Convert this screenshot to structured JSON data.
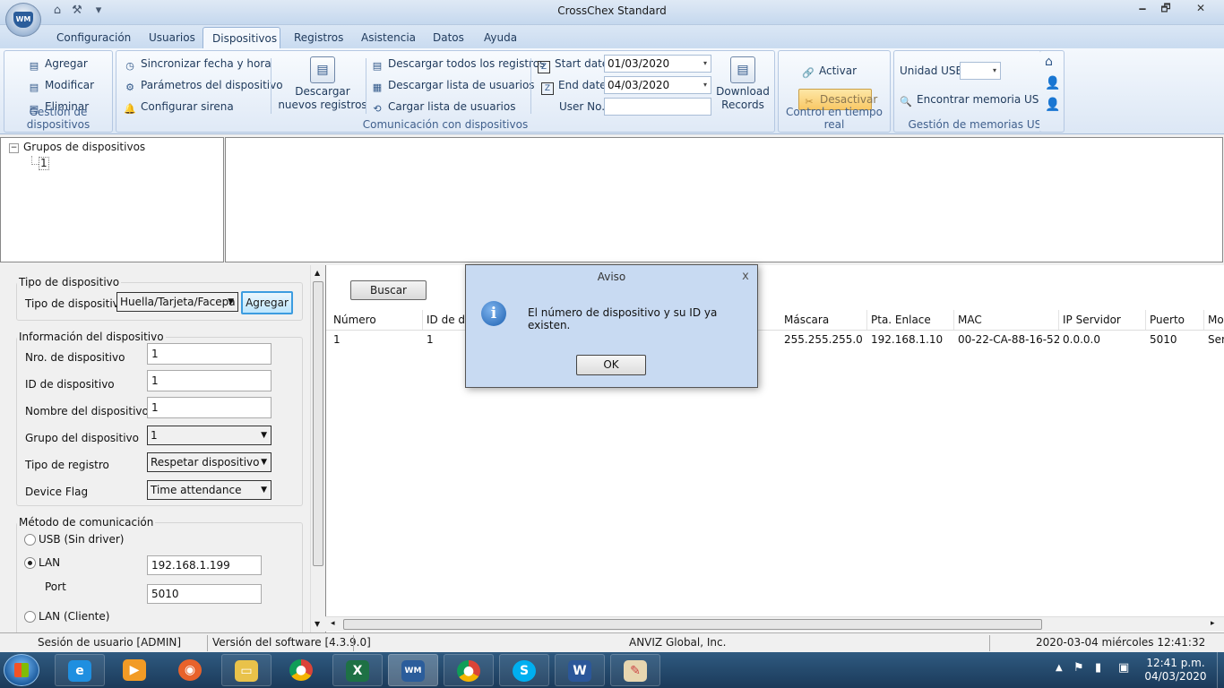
{
  "window": {
    "title": "CrossChex Standard",
    "minimize": "🗕",
    "maximize": "🗗",
    "close": "✕"
  },
  "menu": {
    "tabs": [
      "Configuración",
      "Usuarios",
      "Dispositivos",
      "Registros",
      "Asistencia",
      "Datos",
      "Ayuda"
    ],
    "active": "Dispositivos"
  },
  "ribbon": {
    "device_mgmt": {
      "label": "Gestión de dispositivos",
      "add": "Agregar",
      "modify": "Modificar",
      "delete": "Eliminar"
    },
    "comm": {
      "label": "Comunicación con dispositivos",
      "sync": "Sincronizar fecha y hora",
      "params": "Parámetros del dispositivo",
      "siren": "Configurar sirena",
      "download_new": "Descargar nuevos registros",
      "download_all": "Descargar todos los registros",
      "download_users": "Descargar lista de usuarios",
      "upload_users": "Cargar lista de usuarios",
      "start_label": "Start date",
      "start_value": "01/03/2020",
      "end_label": "End date",
      "end_value": "04/03/2020",
      "userno_label": "User No.",
      "userno_value": "",
      "download_records": "Download Records"
    },
    "realtime": {
      "label": "Control en tiempo real",
      "activate": "Activar",
      "deactivate": "Desactivar"
    },
    "usb": {
      "label": "Gestión de memorias USB",
      "unit_label": "Unidad USB",
      "unit_value": "",
      "find": "Encontrar memoria USB"
    }
  },
  "tree": {
    "root": "Grupos de dispositivos",
    "child": "1",
    "expander": "−"
  },
  "form": {
    "type_legend": "Tipo de dispositivo",
    "type_label": "Tipo de dispositivo",
    "type_value": "Huella/Tarjeta/Facepa",
    "add_button": "Agregar",
    "info_legend": "Información del dispositivo",
    "nro_label": "Nro. de dispositivo",
    "nro_value": "1",
    "id_label": "ID de dispositivo",
    "id_value": "1",
    "name_label": "Nombre del dispositivo",
    "name_value": "1",
    "group_label": "Grupo del dispositivo",
    "group_value": "1",
    "regtype_label": "Tipo de registro",
    "regtype_value": "Respetar dispositivo",
    "flag_label": "Device Flag",
    "flag_value": "Time attendance",
    "comm_legend": "Método de comunicación",
    "usb_label": "USB (Sin driver)",
    "lan_label": "LAN",
    "lan_ip": "192.168.1.199",
    "port_label": "Port",
    "port_value": "5010",
    "lan_client_label": "LAN (Cliente)"
  },
  "grid": {
    "search_button": "Buscar",
    "columns": [
      "Número",
      "ID de dis",
      "Máscara",
      "Pta. Enlace",
      "MAC",
      "IP Servidor",
      "Puerto",
      "Mo"
    ],
    "row": [
      "1",
      "1",
      "255.255.255.0",
      "192.168.1.10",
      "00-22-CA-88-16-52",
      "0.0.0.0",
      "5010",
      "Ser"
    ]
  },
  "status": {
    "session": "Sesión de usuario  [ADMIN]",
    "version": "Versión del software  [4.3.9.0]",
    "company": "ANVIZ Global, Inc.",
    "datetime": "2020-03-04 miércoles 12:41:32"
  },
  "dialog": {
    "title": "Aviso",
    "message": "El número de dispositivo y su ID ya existen.",
    "ok": "OK",
    "close": "x",
    "icon": "i"
  },
  "taskbar": {
    "time": "12:41 p.m.",
    "date": "04/03/2020",
    "apps": [
      "internet-explorer",
      "media-player",
      "firefox",
      "file-explorer",
      "chrome",
      "excel",
      "crosschex",
      "chrome-profile",
      "skype",
      "word",
      "paint"
    ]
  }
}
